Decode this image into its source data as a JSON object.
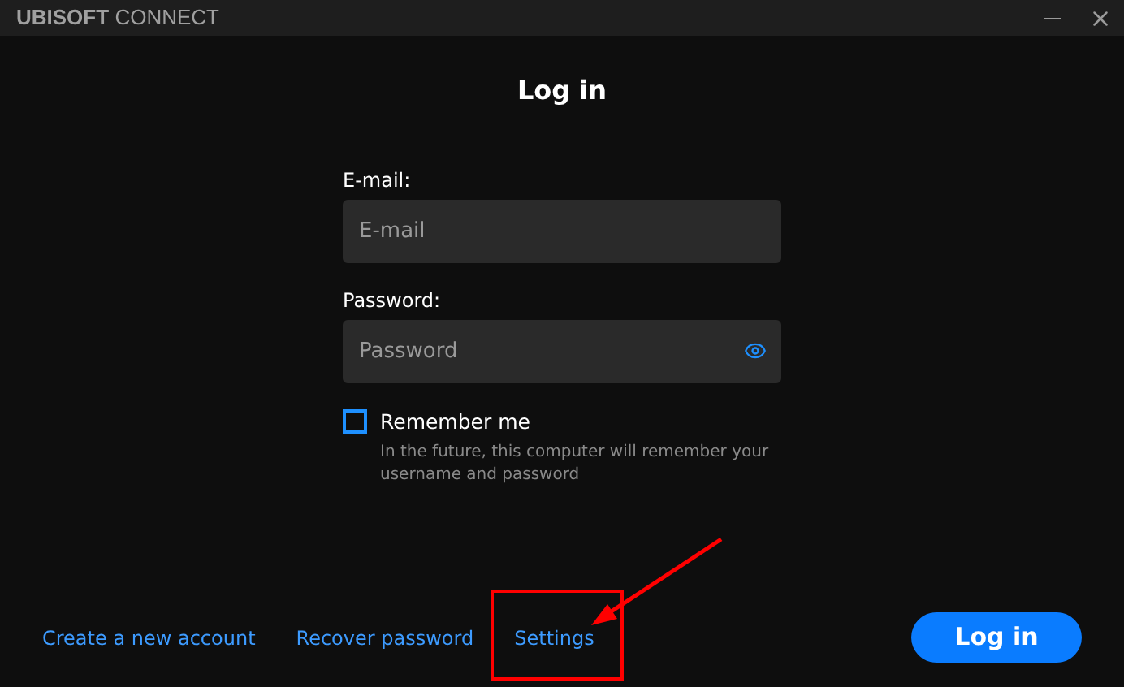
{
  "window": {
    "title_bold": "UBISOFT",
    "title_rest": "CONNECT"
  },
  "heading": "Log in",
  "fields": [
    {
      "label": "E-mail:",
      "placeholder": "E-mail",
      "kind": "text"
    },
    {
      "label": "Password:",
      "placeholder": "Password",
      "kind": "password"
    }
  ],
  "remember": {
    "label": "Remember me",
    "checked": false,
    "hint": "In the future, this computer will remember your username and password"
  },
  "links": [
    "Create a new account",
    "Recover password",
    "Settings"
  ],
  "login_button": "Log in"
}
